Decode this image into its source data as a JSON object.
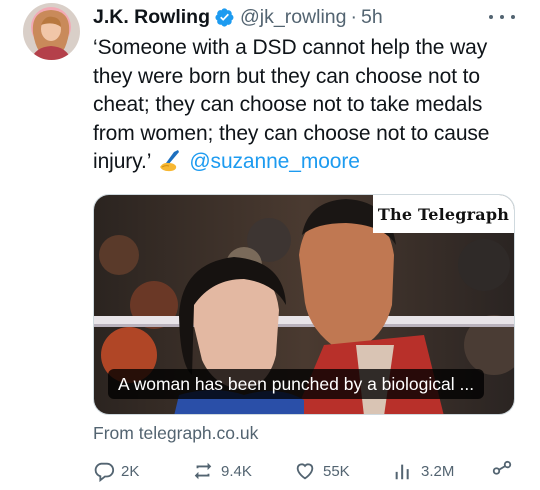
{
  "tweet": {
    "author_name": "J.K. Rowling",
    "verified_icon": "verified-badge-icon",
    "handle": "@jk_rowling",
    "separator": "·",
    "time": "5h",
    "text_lines": [
      "‘Someone with a DSD cannot help the way",
      "they were born but they can choose not to",
      "cheat; they can choose not to take medals",
      "from women; they can choose not to cause",
      "injury.’"
    ],
    "emoji_icon": "writing-hand-icon",
    "mention": "@suzanne_moore"
  },
  "link_card": {
    "publisher": "The Telegraph",
    "caption": "A woman has been punched by a biological ...",
    "source": "From telegraph.co.uk"
  },
  "actions": {
    "replies": "2K",
    "reposts": "9.4K",
    "likes": "55K",
    "views": "3.2M"
  },
  "colors": {
    "accent": "#1d9bf0",
    "text": "#0f1419",
    "secondary": "#536471",
    "border": "#cfd9de"
  }
}
